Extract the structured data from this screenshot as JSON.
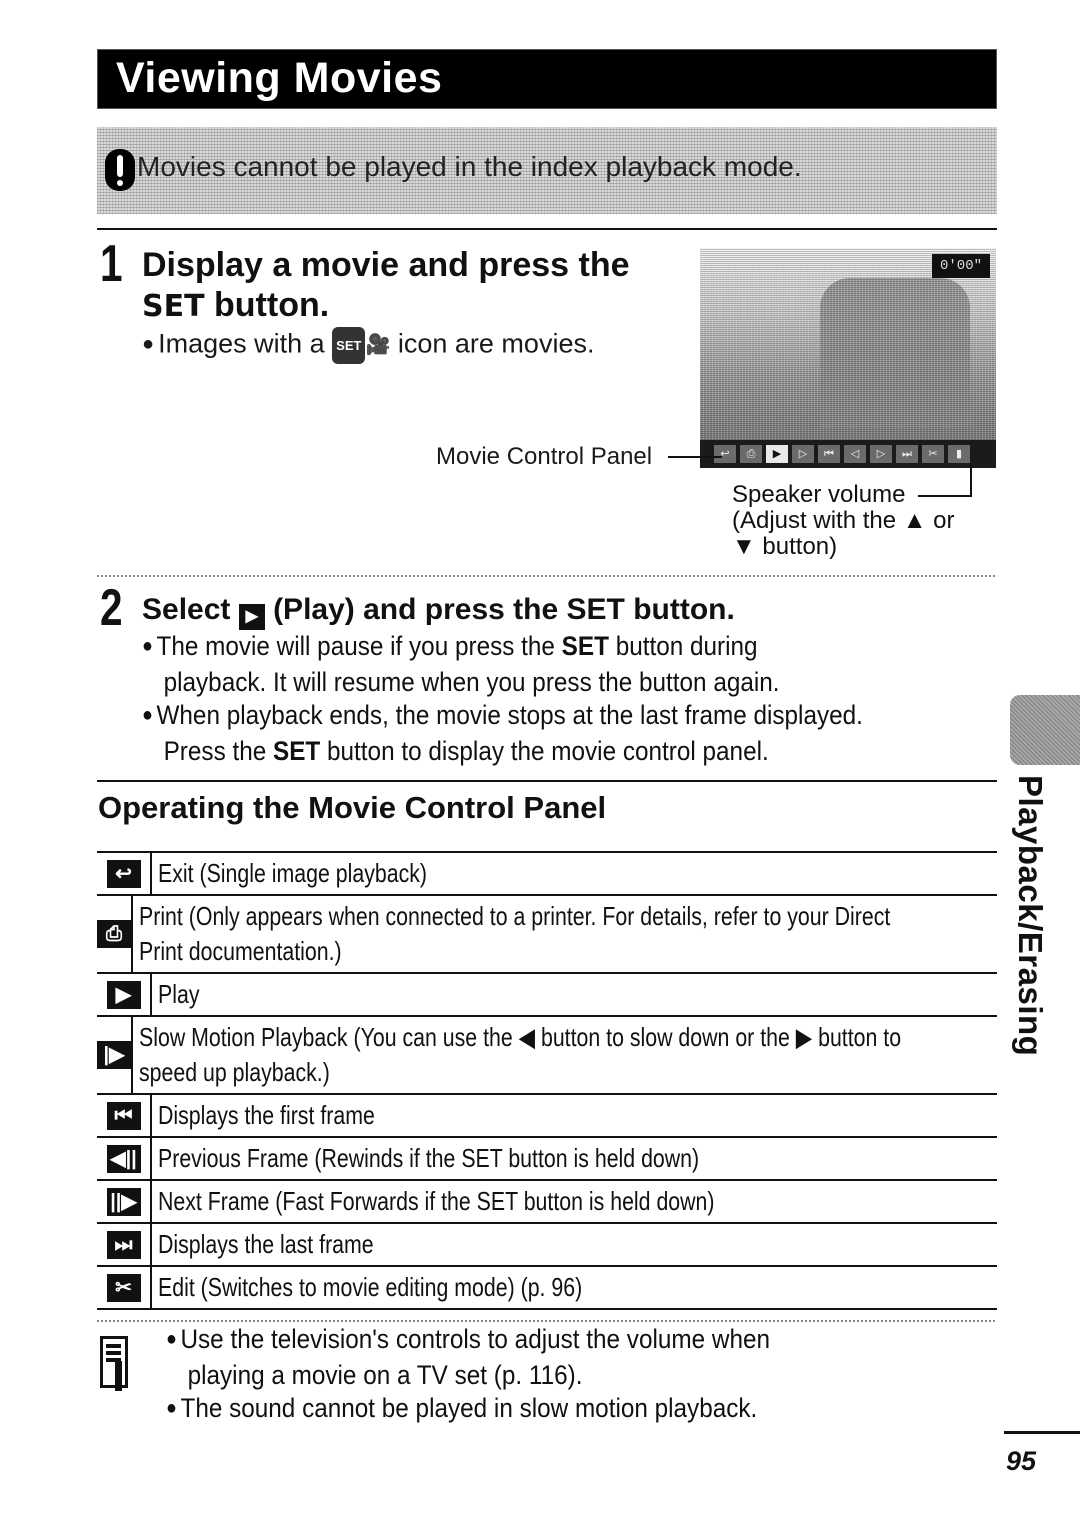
{
  "header": {
    "title": "Viewing Movies"
  },
  "caution": {
    "icon": "caution-icon",
    "text": "Movies cannot be played in the index playback mode."
  },
  "step1": {
    "number": "1",
    "title_line1": "Display a movie and press the",
    "title_line2_bold": "SET",
    "title_line2_rest": " button.",
    "bullet_pre": "Images with a ",
    "bullet_icon": "SET-movie-icon",
    "bullet_icon_text": "SET",
    "bullet_post": " icon are movies."
  },
  "screen": {
    "time_display": "0'00\"",
    "controls": [
      "exit",
      "print",
      "play",
      "slow",
      "first",
      "prev",
      "next",
      "last",
      "edit",
      "volume"
    ],
    "control_glyphs": [
      "↩",
      "⎙",
      "▶",
      "▷",
      "⏮",
      "◁",
      "▷",
      "⏭",
      "✂",
      "▮"
    ]
  },
  "callouts": {
    "movie_control_panel": "Movie Control Panel",
    "speaker_volume": "Speaker volume",
    "adjust_line1": "(Adjust with the ▲ or",
    "adjust_line2": "▼ button)"
  },
  "step2": {
    "number": "2",
    "title_pre": "Select ",
    "title_icon": "play-icon",
    "title_mid": " (Play) and press the ",
    "title_bold": "SET",
    "title_post": " button.",
    "bullets": [
      {
        "line1_pre": "The movie will pause if you press the ",
        "line1_bold": "SET",
        "line1_post": " button during",
        "line2": "playback. It will resume when you press the button again."
      },
      {
        "line1": "When playback ends, the movie stops at the last frame displayed.",
        "line2_pre": "Press the ",
        "line2_bold": "SET",
        "line2_post": " button to display the movie control panel."
      }
    ]
  },
  "section": {
    "title": "Operating the Movie Control Panel"
  },
  "controls_table": [
    {
      "icon": "exit-icon",
      "glyph": "↩",
      "lines": [
        "Exit (Single image playback)"
      ]
    },
    {
      "icon": "print-icon",
      "glyph": "⎙",
      "lines": [
        "Print (Only appears when connected to a printer. For details, refer to your Direct",
        "Print documentation.)"
      ]
    },
    {
      "icon": "play-icon",
      "glyph": "▶",
      "lines": [
        "Play"
      ]
    },
    {
      "icon": "slow-motion-icon",
      "glyph": "|▶",
      "lines": [
        "Slow Motion Playback (You can use the ◀ button to slow down or the ▶ button to",
        "speed up playback.)"
      ]
    },
    {
      "icon": "first-frame-icon",
      "glyph": "⏮",
      "lines": [
        "Displays the first frame"
      ]
    },
    {
      "icon": "previous-frame-icon",
      "glyph": "◀||",
      "lines": [
        "Previous Frame (Rewinds if the SET button is held down)"
      ]
    },
    {
      "icon": "next-frame-icon",
      "glyph": "||▶",
      "lines": [
        "Next Frame (Fast Forwards if the SET button is held down)"
      ]
    },
    {
      "icon": "last-frame-icon",
      "glyph": "⏭",
      "lines": [
        "Displays the last frame"
      ]
    },
    {
      "icon": "edit-scissors-icon",
      "glyph": "✂",
      "lines": [
        "Edit (Switches to movie editing mode) (p. 96)"
      ]
    }
  ],
  "notes": {
    "icon": "memo-icon",
    "bullets": [
      {
        "line1": "Use the television's controls to adjust the volume when",
        "line2": "playing a movie on a TV set (p. 116)."
      },
      {
        "line1": "The sound cannot be played in slow motion playback."
      }
    ]
  },
  "side_tab": {
    "label": "Playback/Erasing"
  },
  "footer": {
    "page_number": "95"
  }
}
